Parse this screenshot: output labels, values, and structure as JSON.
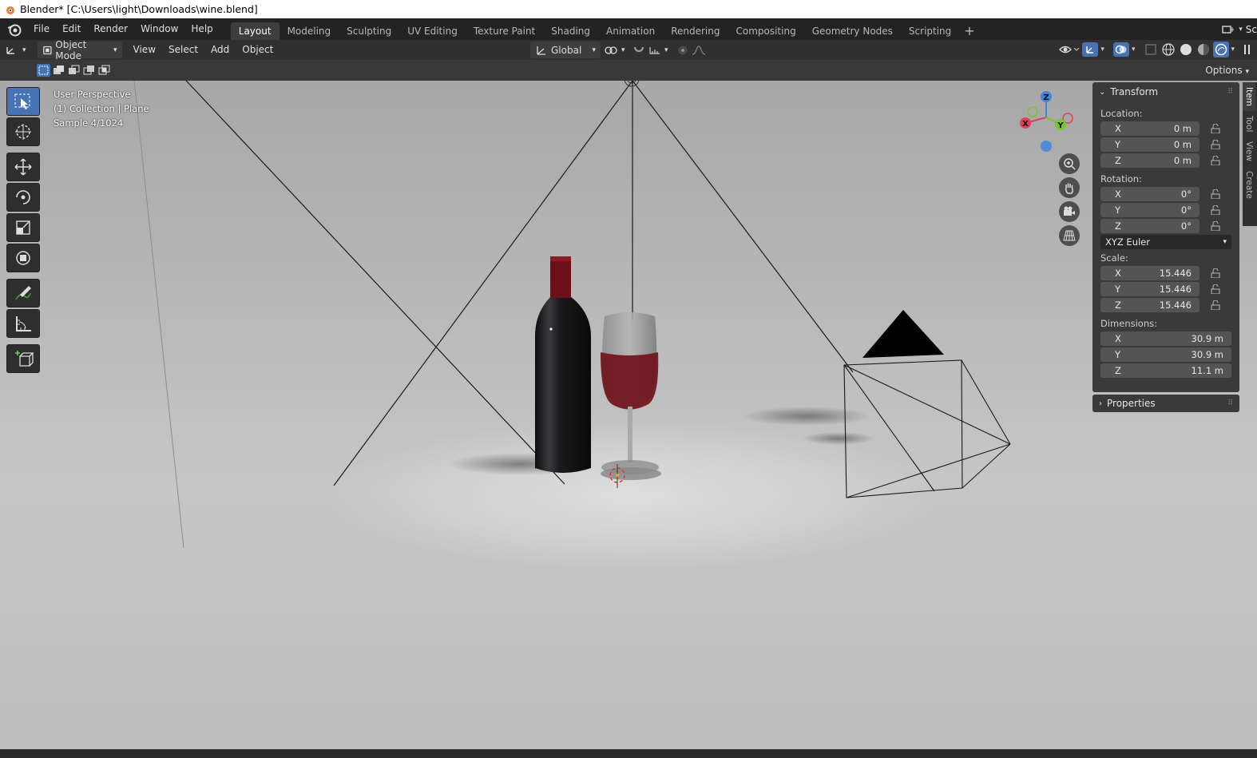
{
  "window": {
    "title": "Blender* [C:\\Users\\light\\Downloads\\wine.blend]"
  },
  "topbar": {
    "menus": [
      "File",
      "Edit",
      "Render",
      "Window",
      "Help"
    ],
    "workspaces": [
      "Layout",
      "Modeling",
      "Sculpting",
      "UV Editing",
      "Texture Paint",
      "Shading",
      "Animation",
      "Rendering",
      "Compositing",
      "Geometry Nodes",
      "Scripting"
    ],
    "active_workspace": "Layout",
    "add_workspace": "+",
    "scene_label": "Sc"
  },
  "header": {
    "mode": "Object Mode",
    "menus": [
      "View",
      "Select",
      "Add",
      "Object"
    ],
    "orientation": "Global"
  },
  "toolheader": {
    "options": "Options"
  },
  "viewport": {
    "overlay": [
      "User Perspective",
      "(1) Collection | Plane",
      "Sample 4/1024"
    ],
    "gizmo": {
      "x": "X",
      "y": "Y",
      "z": "Z"
    }
  },
  "npanel": {
    "transform_title": "Transform",
    "location_label": "Location:",
    "location": [
      {
        "axis": "X",
        "value": "0 m"
      },
      {
        "axis": "Y",
        "value": "0 m"
      },
      {
        "axis": "Z",
        "value": "0 m"
      }
    ],
    "rotation_label": "Rotation:",
    "rotation": [
      {
        "axis": "X",
        "value": "0°"
      },
      {
        "axis": "Y",
        "value": "0°"
      },
      {
        "axis": "Z",
        "value": "0°"
      }
    ],
    "rotation_mode": "XYZ Euler",
    "scale_label": "Scale:",
    "scale": [
      {
        "axis": "X",
        "value": "15.446"
      },
      {
        "axis": "Y",
        "value": "15.446"
      },
      {
        "axis": "Z",
        "value": "15.446"
      }
    ],
    "dimensions_label": "Dimensions:",
    "dimensions": [
      {
        "axis": "X",
        "value": "30.9 m"
      },
      {
        "axis": "Y",
        "value": "30.9 m"
      },
      {
        "axis": "Z",
        "value": "11.1 m"
      }
    ],
    "properties_title": "Properties",
    "tabs": [
      "Item",
      "Tool",
      "View",
      "Create"
    ]
  },
  "colors": {
    "accent": "#4772b3",
    "axis_x": "#e34153",
    "axis_y": "#7bc42d",
    "axis_z": "#3f86d9",
    "wine": "#6e1018"
  }
}
